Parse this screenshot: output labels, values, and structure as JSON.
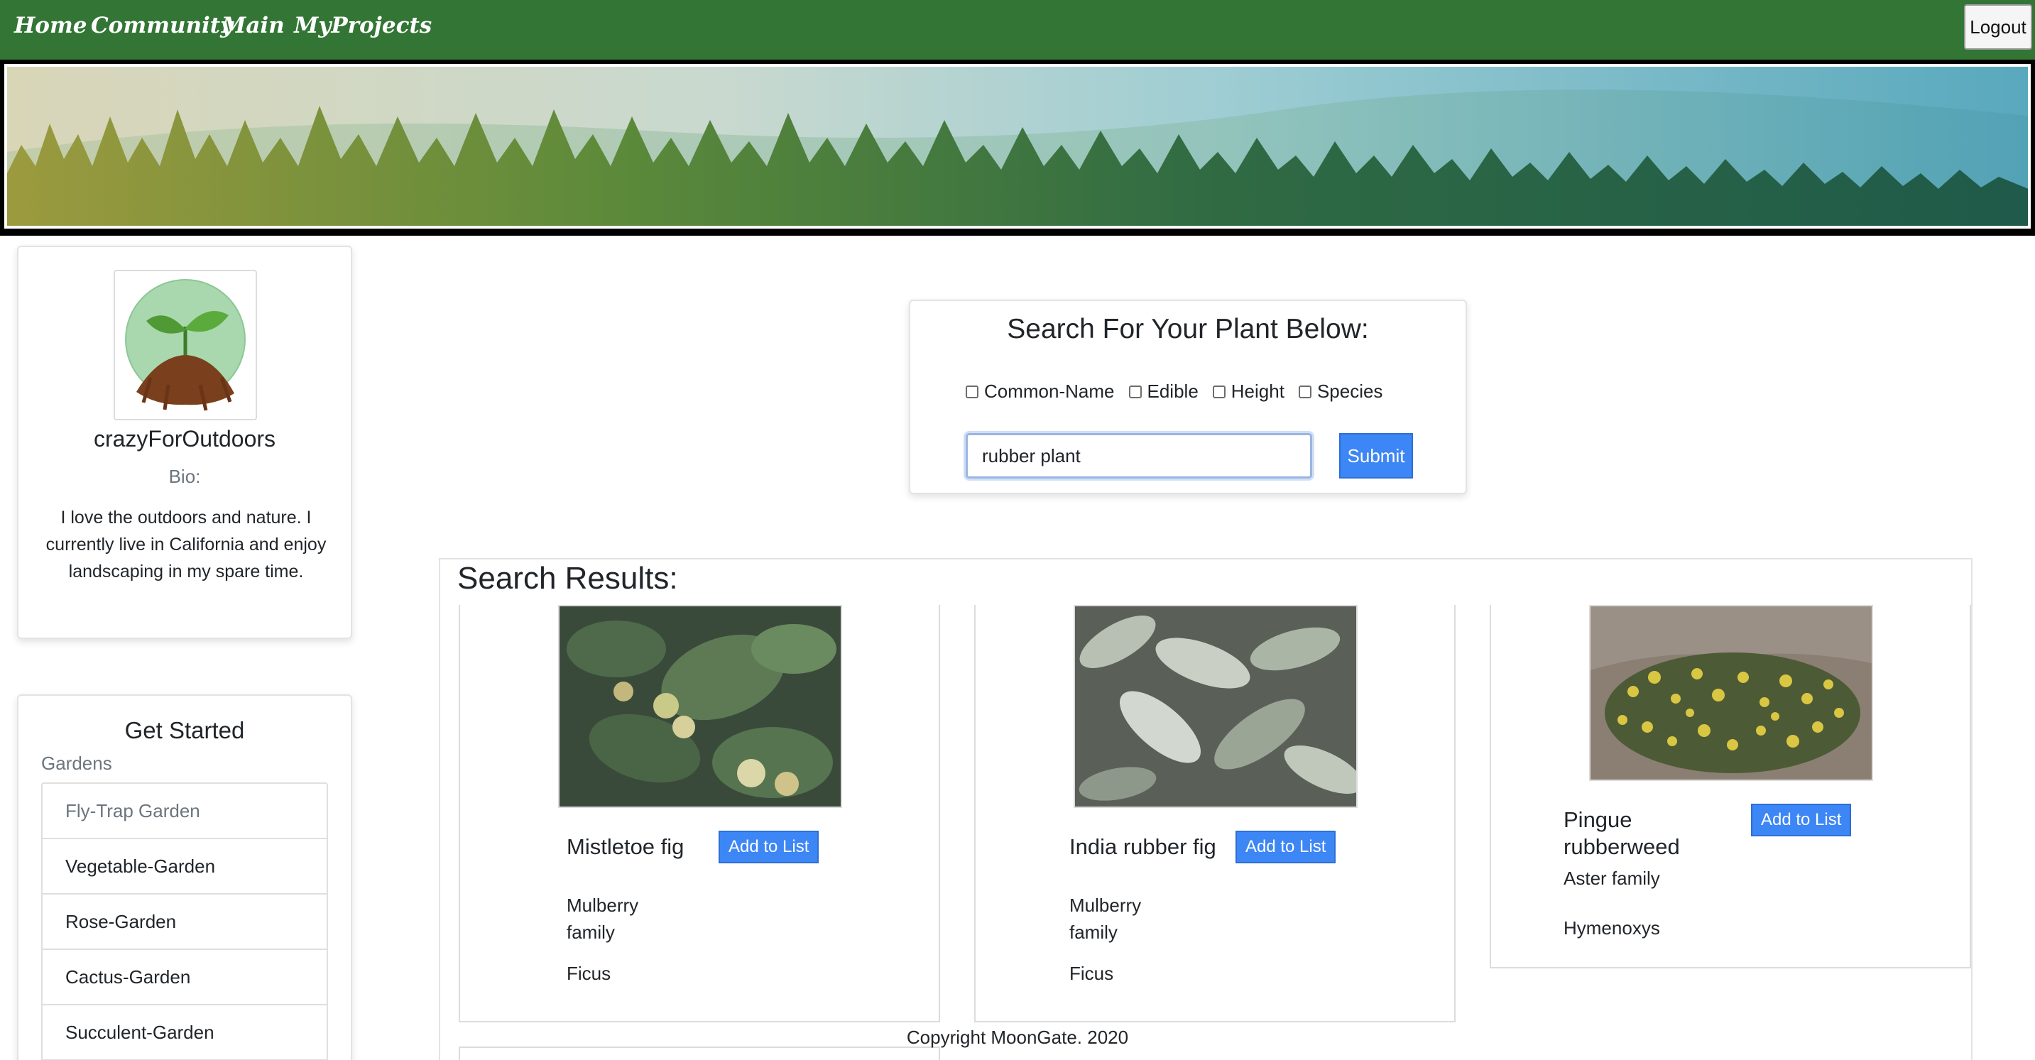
{
  "nav": {
    "links": [
      "Home",
      "Community",
      "Main",
      "MyProjects"
    ],
    "logout": "Logout",
    "color": "#337535"
  },
  "banner": {
    "icon": "forest-banner-image"
  },
  "profile": {
    "avatar_icon": "seedling-avatar",
    "username": "crazyForOutdoors",
    "bio_label": "Bio:",
    "bio": "I love the outdoors and nature. I currently live in California and enjoy landscaping in my spare time."
  },
  "get_started": {
    "title": "Get Started",
    "subtitle": "Gardens",
    "items": [
      "Fly-Trap Garden",
      "Vegetable-Garden",
      "Rose-Garden",
      "Cactus-Garden",
      "Succulent-Garden"
    ]
  },
  "search": {
    "title": "Search For Your Plant Below:",
    "options": [
      "Common-Name",
      "Edible",
      "Height",
      "Species"
    ],
    "value": "rubber plant",
    "submit": "Submit"
  },
  "results": {
    "title": "Search Results:",
    "add_label": "Add to List",
    "items": [
      {
        "name": "Mistletoe fig",
        "family": "Mulberry family",
        "genus": "Ficus"
      },
      {
        "name": "India rubber fig",
        "family": "Mulberry family",
        "genus": "Ficus"
      },
      {
        "name": "Pingue rubberweed",
        "family": "Aster family",
        "genus": "Hymenoxys"
      }
    ]
  },
  "footer": "Copyright MoonGate. 2020",
  "accent": "#3d86f5"
}
